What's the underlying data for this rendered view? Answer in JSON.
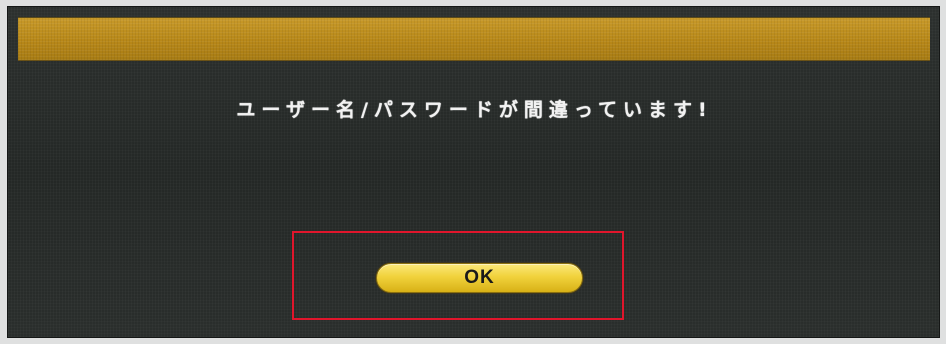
{
  "dialog": {
    "message": "ユーザー名/パスワードが間違っています!",
    "ok_label": "OK"
  },
  "colors": {
    "title_bar": "#b88818",
    "dialog_background": "#272b29",
    "button": "#f1d23c",
    "highlight_outline": "#e0162c"
  }
}
